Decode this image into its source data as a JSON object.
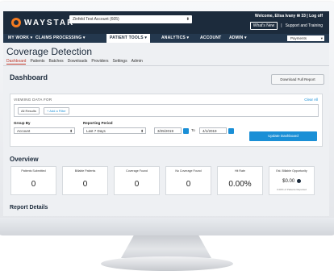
{
  "header": {
    "logo_text": "WAYSTAR",
    "account_select": "Zinfeld Test Account (605)",
    "welcome": "Welcome, Elisa Ivany",
    "messages": "33",
    "logoff": "Log off",
    "whats_new": "What's New",
    "support": "Support and Training"
  },
  "nav": {
    "items": [
      "MY WORK",
      "CLAIMS PROCESSING",
      "PATIENT TOOLS",
      "ANALYTICS",
      "ACCOUNT",
      "ADMIN"
    ],
    "payments": "Payments"
  },
  "page": {
    "title": "Coverage Detection",
    "subnav": [
      "Dashboard",
      "Patients",
      "Batches",
      "Downloads",
      "Providers",
      "Settings",
      "Admin"
    ]
  },
  "dashboard": {
    "title": "Dashboard",
    "download_button": "Download Full Report",
    "viewing_label": "VIEWING DATA FOR",
    "clear_all": "Clear All",
    "all_results": "All Results",
    "add_filter": "+ Add a Filter",
    "group_by_label": "Group By",
    "group_by_value": "Account",
    "reporting_label": "Reporting Period",
    "reporting_value": "Last 7 Days",
    "date_from": "3/25/2019",
    "to_label": "To",
    "date_to": "4/1/2019",
    "update_button": "Update Dashboard"
  },
  "overview": {
    "title": "Overview",
    "cards": [
      {
        "label": "Patients Submitted",
        "value": "0"
      },
      {
        "label": "Billable Patients",
        "value": "0"
      },
      {
        "label": "Coverage Found",
        "value": "0"
      },
      {
        "label": "No Coverage Found",
        "value": "0"
      },
      {
        "label": "Hit Rate",
        "value": "0.00%"
      },
      {
        "label": "Est. Billable Opportunity",
        "value": "$0.00",
        "sub": "0.00% of Patients Reported"
      }
    ]
  },
  "report_details": {
    "title": "Report Details"
  }
}
